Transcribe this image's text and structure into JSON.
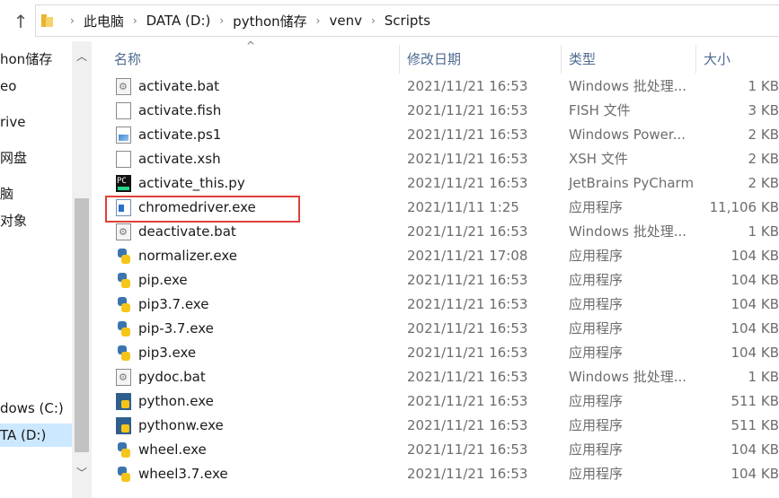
{
  "address": {
    "crumbs": [
      "此电脑",
      "DATA (D:)",
      "python储存",
      "venv",
      "Scripts"
    ]
  },
  "nav": {
    "items": [
      "hon储存",
      "eo",
      "rive",
      "网盘",
      "脑",
      "对象",
      "",
      "",
      "",
      "",
      "",
      "",
      "dows (C:)",
      "TA (D:)"
    ]
  },
  "columns": {
    "name": "名称",
    "date": "修改日期",
    "type": "类型",
    "size": "大小"
  },
  "files": [
    {
      "icon": "bat",
      "name": "activate.bat",
      "date": "2021/11/21 16:53",
      "type": "Windows 批处理...",
      "size": "1 KB"
    },
    {
      "icon": "file",
      "name": "activate.fish",
      "date": "2021/11/21 16:53",
      "type": "FISH 文件",
      "size": "3 KB"
    },
    {
      "icon": "ps",
      "name": "activate.ps1",
      "date": "2021/11/21 16:53",
      "type": "Windows Power...",
      "size": "2 KB"
    },
    {
      "icon": "file",
      "name": "activate.xsh",
      "date": "2021/11/21 16:53",
      "type": "XSH 文件",
      "size": "2 KB"
    },
    {
      "icon": "pc",
      "name": "activate_this.py",
      "date": "2021/11/21 16:53",
      "type": "JetBrains PyCharm",
      "size": "2 KB"
    },
    {
      "icon": "exe",
      "name": "chromedriver.exe",
      "date": "2021/11/11 1:25",
      "type": "应用程序",
      "size": "11,106 KB"
    },
    {
      "icon": "bat",
      "name": "deactivate.bat",
      "date": "2021/11/21 16:53",
      "type": "Windows 批处理...",
      "size": "1 KB"
    },
    {
      "icon": "py",
      "name": "normalizer.exe",
      "date": "2021/11/21 17:08",
      "type": "应用程序",
      "size": "104 KB"
    },
    {
      "icon": "py",
      "name": "pip.exe",
      "date": "2021/11/21 16:53",
      "type": "应用程序",
      "size": "104 KB"
    },
    {
      "icon": "py",
      "name": "pip3.7.exe",
      "date": "2021/11/21 16:53",
      "type": "应用程序",
      "size": "104 KB"
    },
    {
      "icon": "py",
      "name": "pip-3.7.exe",
      "date": "2021/11/21 16:53",
      "type": "应用程序",
      "size": "104 KB"
    },
    {
      "icon": "py",
      "name": "pip3.exe",
      "date": "2021/11/21 16:53",
      "type": "应用程序",
      "size": "104 KB"
    },
    {
      "icon": "bat",
      "name": "pydoc.bat",
      "date": "2021/11/21 16:53",
      "type": "Windows 批处理...",
      "size": "1 KB"
    },
    {
      "icon": "pyexe",
      "name": "python.exe",
      "date": "2021/11/21 16:53",
      "type": "应用程序",
      "size": "511 KB"
    },
    {
      "icon": "pyexe",
      "name": "pythonw.exe",
      "date": "2021/11/21 16:53",
      "type": "应用程序",
      "size": "511 KB"
    },
    {
      "icon": "py",
      "name": "wheel.exe",
      "date": "2021/11/21 16:53",
      "type": "应用程序",
      "size": "104 KB"
    },
    {
      "icon": "py",
      "name": "wheel3.7.exe",
      "date": "2021/11/21 16:53",
      "type": "应用程序",
      "size": "104 KB"
    }
  ]
}
